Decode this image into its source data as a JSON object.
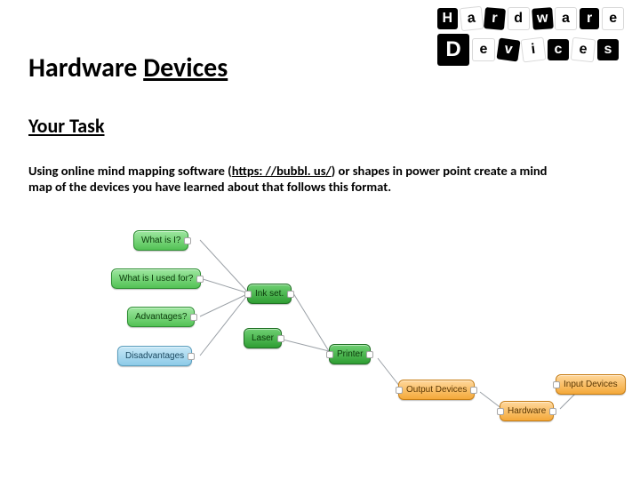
{
  "title": {
    "plain": "Hardware ",
    "underlined": "Devices"
  },
  "subtitle": "Your Task",
  "body": {
    "pre": "Using online mind mapping software  (",
    "link_text": "https: //bubbl. us/",
    "link_href": "https://bubbl.us/",
    "post": ") or shapes in power point create a mind map of the devices you have learned about that follows this format."
  },
  "logo": {
    "row1": [
      "H",
      "a",
      "r",
      "d",
      "w",
      "a",
      "r",
      "e"
    ],
    "row2": [
      "D",
      "e",
      "v",
      "i",
      "c",
      "e",
      "s"
    ]
  },
  "mindmap": {
    "left_column": [
      {
        "label": "What is I?"
      },
      {
        "label": "What is I used for?"
      },
      {
        "label": "Advantages?"
      },
      {
        "label": "Disadvantages"
      }
    ],
    "mid_column": [
      {
        "label": "Ink set."
      },
      {
        "label": "Laser"
      }
    ],
    "right_chain": [
      {
        "label": "Printer"
      },
      {
        "label": "Output Devices"
      },
      {
        "label": "Hardware"
      },
      {
        "label": "Input Devices"
      }
    ]
  }
}
